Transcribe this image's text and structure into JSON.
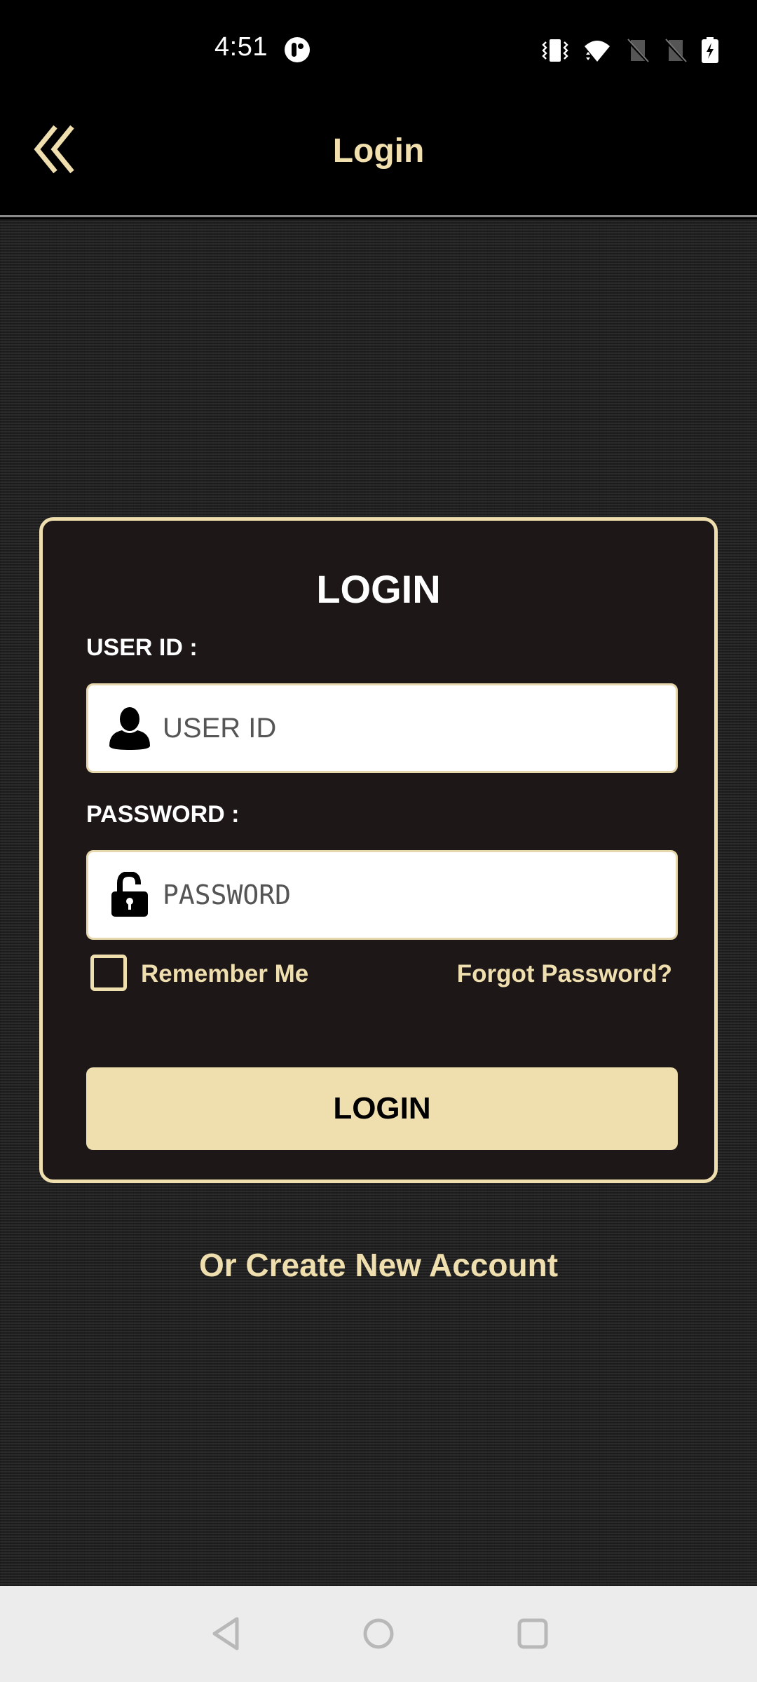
{
  "status_bar": {
    "time": "4:51",
    "icons": [
      "app-notification-icon",
      "vibrate-icon",
      "wifi-icon",
      "no-sim-icon",
      "no-sim-icon",
      "battery-charging-icon"
    ]
  },
  "app_bar": {
    "back_icon": "double-chevron-left-icon",
    "title": "Login"
  },
  "login_card": {
    "title": "LOGIN",
    "user_id": {
      "label": "USER ID :",
      "placeholder": "USER ID",
      "value": "",
      "icon": "user-icon"
    },
    "password": {
      "label": "PASSWORD :",
      "placeholder": "PASSWORD",
      "value": "",
      "icon": "unlock-icon"
    },
    "remember_me": {
      "label": "Remember Me",
      "checked": false
    },
    "forgot_password": "Forgot Password?",
    "login_button": "LOGIN"
  },
  "create_account": "Or Create New Account",
  "nav_bar": {
    "buttons": [
      "back",
      "home",
      "recents"
    ]
  },
  "colors": {
    "accent": "#f0dfae",
    "card_bg": "#1d1718",
    "background": "#242424"
  }
}
